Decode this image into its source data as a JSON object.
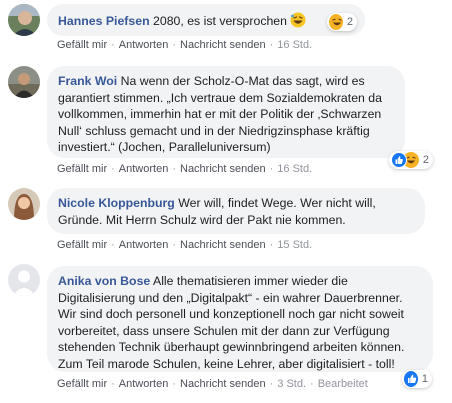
{
  "actions": {
    "like": "Gefällt mir",
    "reply": "Antworten",
    "send": "Nachricht senden",
    "sep": "·"
  },
  "colors": {
    "author": "#385898",
    "bubble": "#f2f3f5",
    "like_blue": "#1877f2",
    "laugh_yellow": "#f7b125",
    "love_red": "#f33e58"
  },
  "comments": [
    {
      "author": "Hannes Piefsen",
      "text": " 2080, es ist versprochen",
      "inline_emoji": "laughing-emoji",
      "time": "16 Std.",
      "reactions": [
        "laugh"
      ],
      "reaction_count": "2"
    },
    {
      "author": "Frank Woi",
      "text": " Na wenn der Scholz-O-Mat das sagt, wird es garantiert stimmen. „Ich vertraue dem Sozialdemokraten da vollkommen, immerhin hat er mit der Politik der ‚Schwarzen Null‘ schluss gemacht und in der Niedrigzinsphase kräftig investiert.“ (Jochen, Paralleluniversum)",
      "time": "16 Std.",
      "reactions": [
        "like",
        "laugh"
      ],
      "reaction_count": "2"
    },
    {
      "author": "Nicole Kloppenburg",
      "text": " Wer will, findet Wege. Wer nicht will, Gründe. Mit Herrn Schulz wird der Pakt nie kommen.",
      "time": "15 Std."
    },
    {
      "author": "Anika von Bose",
      "text": " Alle thematisieren immer wieder die Digitalisierung und den „Digitalpakt“ - ein wahrer Dauerbrenner. Wir sind doch personell und konzeptionell noch gar nicht soweit vorbereitet, dass unsere Schulen mit der dann zur Verfügung stehenden Technik überhaupt gewinnbringend arbeiten können. Zum Teil marode Schulen, keine Lehrer, aber digitalisiert - toll!",
      "time": "3 Std.",
      "edited": "Bearbeitet",
      "reactions": [
        "like"
      ],
      "reaction_count": "1"
    }
  ]
}
